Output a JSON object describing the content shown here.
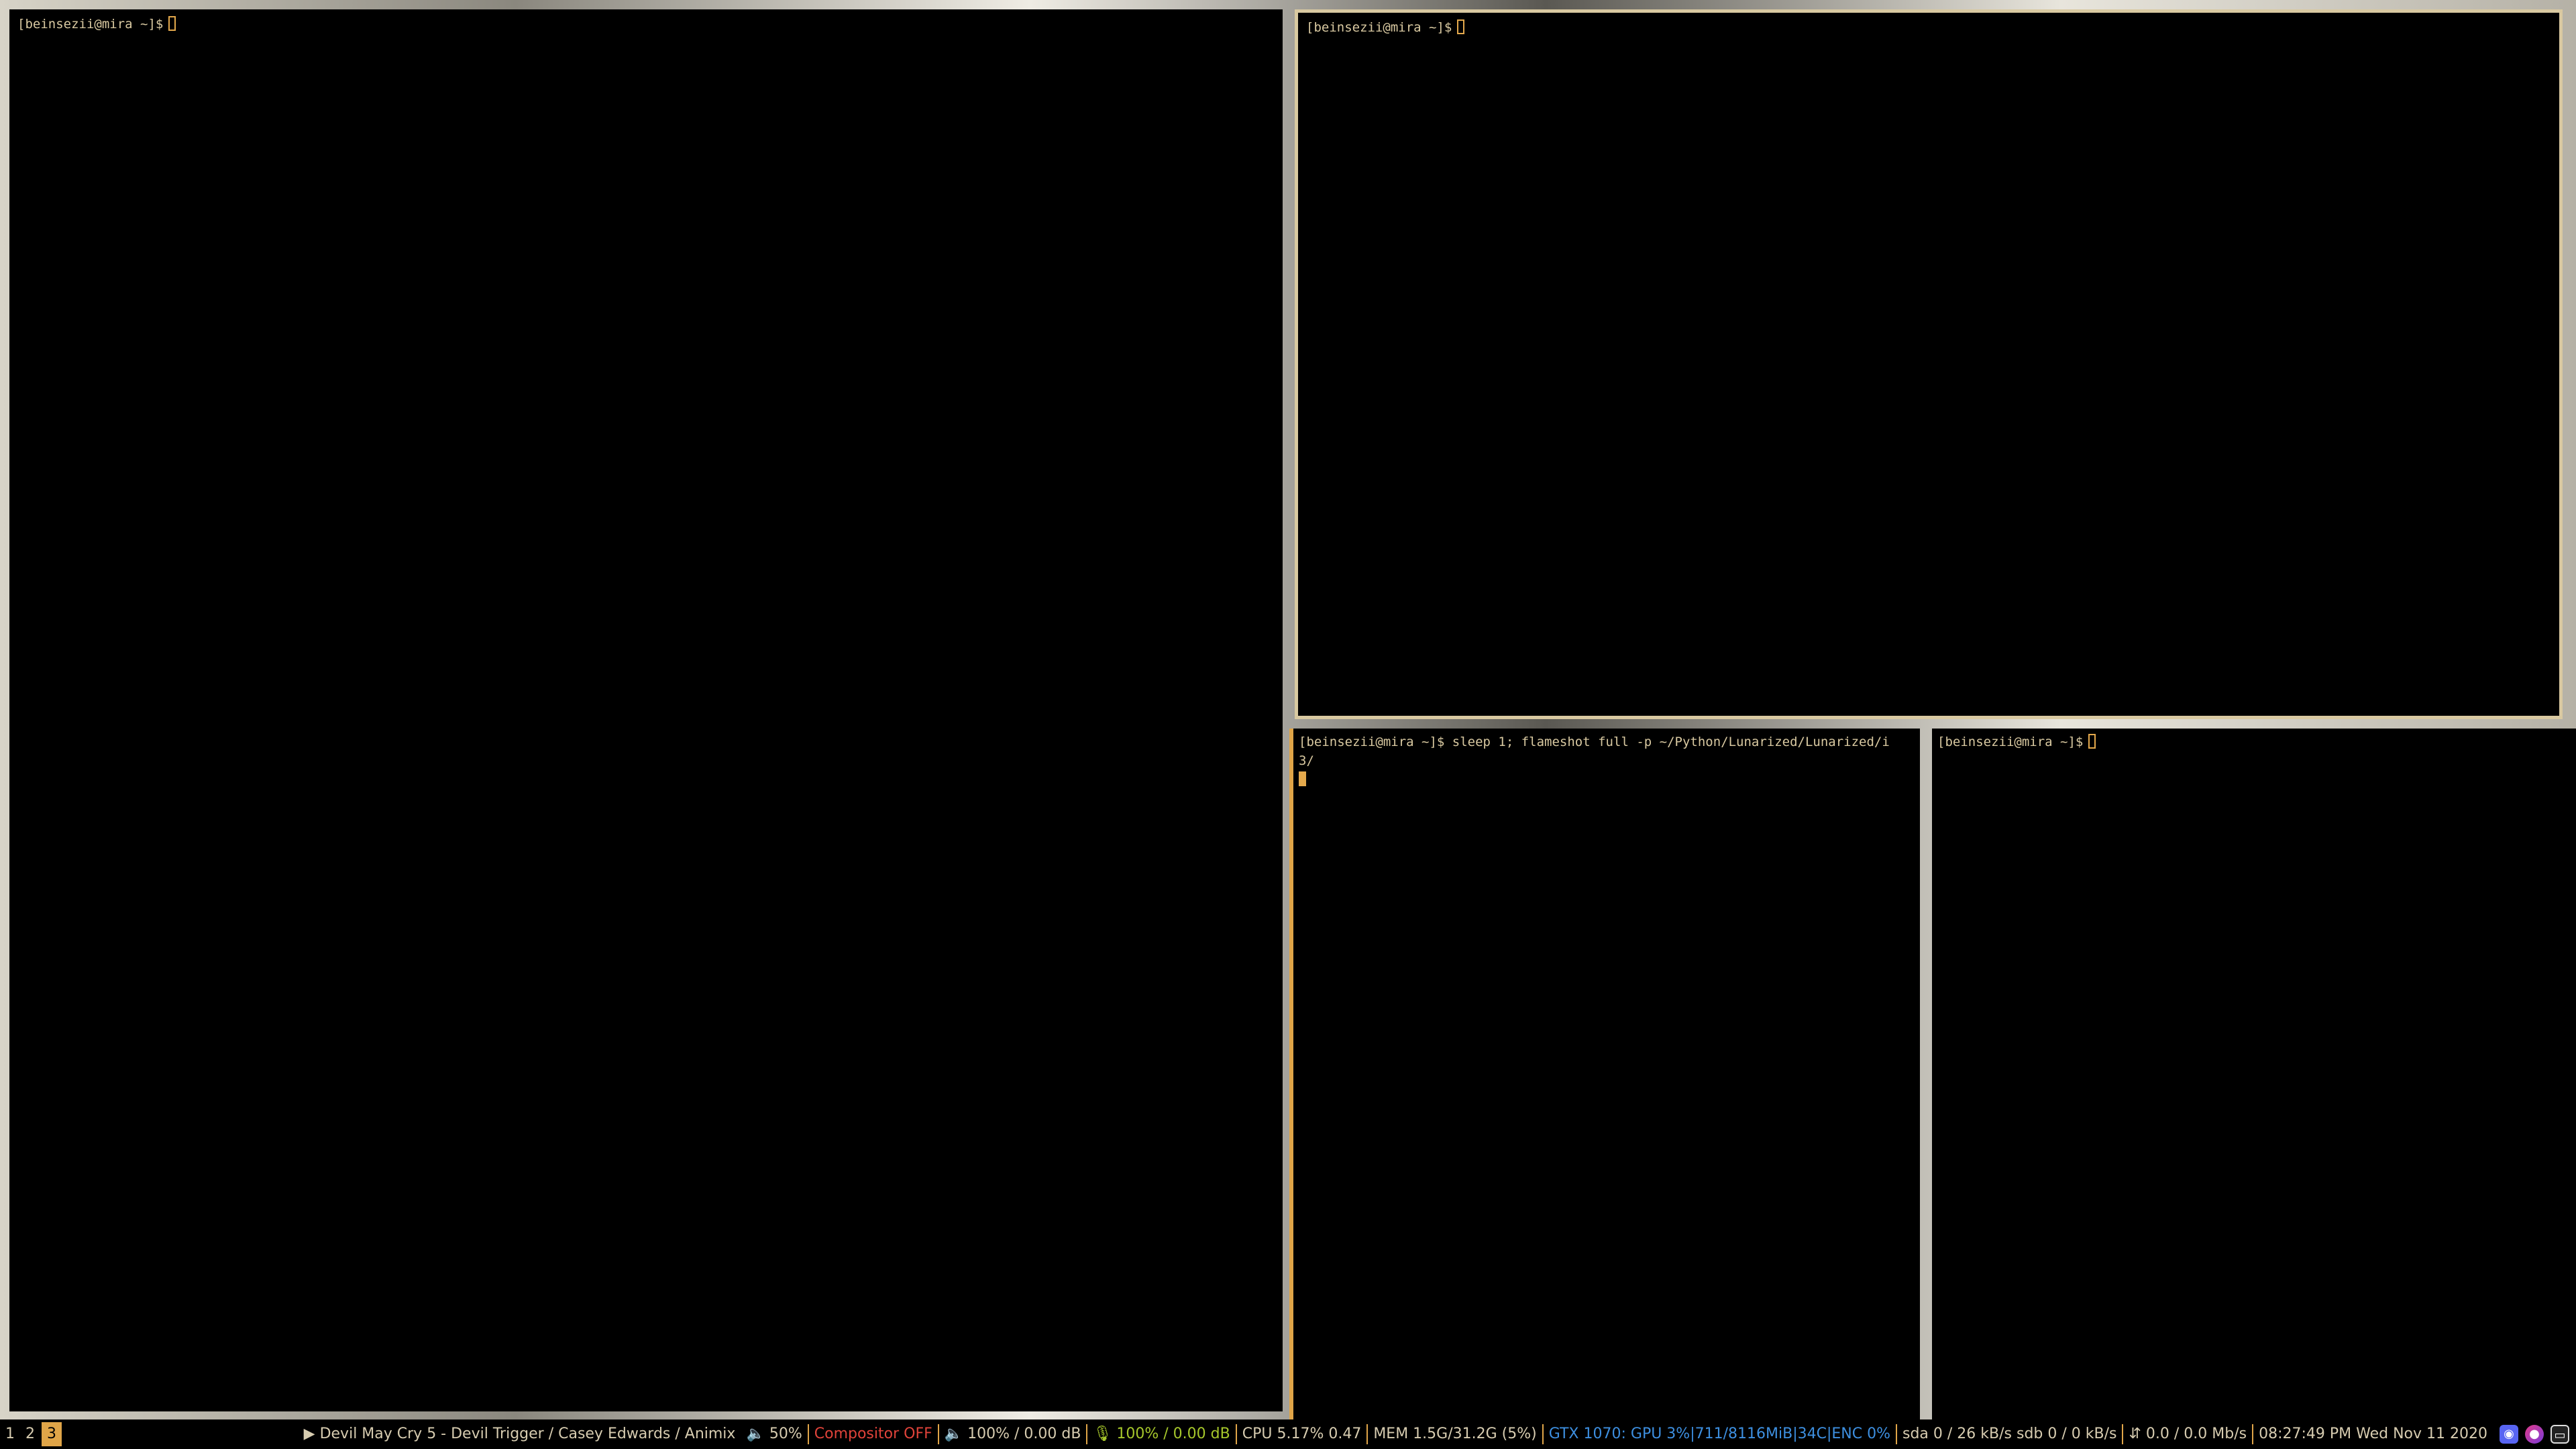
{
  "terminals": [
    {
      "id": "left",
      "prompt": "[beinsezii@mira ~]$",
      "command": ""
    },
    {
      "id": "top-right",
      "prompt": "[beinsezii@mira ~]$",
      "command": ""
    },
    {
      "id": "bottom-middle",
      "prompt": "[beinsezii@mira ~]$",
      "command": " sleep 1; flameshot full -p ~/Python/Lunarized/Lunarized/i",
      "continuation": "3/"
    },
    {
      "id": "bottom-right",
      "prompt": "[beinsezii@mira ~]$",
      "command": ""
    }
  ],
  "statusbar": {
    "workspaces": [
      "1",
      "2",
      "3"
    ],
    "active_workspace": "3",
    "now_playing": "▶ Devil May Cry 5 - Devil Trigger / Casey Edwards / Animix",
    "volume": "🔈 50%",
    "compositor": "Compositor OFF",
    "audio_out": "🔈 100% / 0.00 dB",
    "audio_in": "🎙 100% / 0.00 dB",
    "cpu": "CPU 5.17%   0.47",
    "mem": "MEM 1.5G/31.2G (5%)",
    "gpu": "GTX 1070: GPU 3%|711/8116MiB|34C|ENC 0%",
    "disk": "sda 0  /  26 kB/s   sdb 0  /  0 kB/s",
    "net": "⇵ 0.0  /  0.0 Mb/s",
    "clock": "08:27:49 PM Wed Nov 11 2020"
  },
  "colors": {
    "accent": "#e0a548",
    "terminal_text": "#d9c9a1",
    "compositor_off": "#e0433a",
    "mic": "#a6c72b",
    "gpu": "#3d8fe0"
  },
  "tray_icons": [
    "discord-icon",
    "app-icon",
    "monitor-icon"
  ]
}
